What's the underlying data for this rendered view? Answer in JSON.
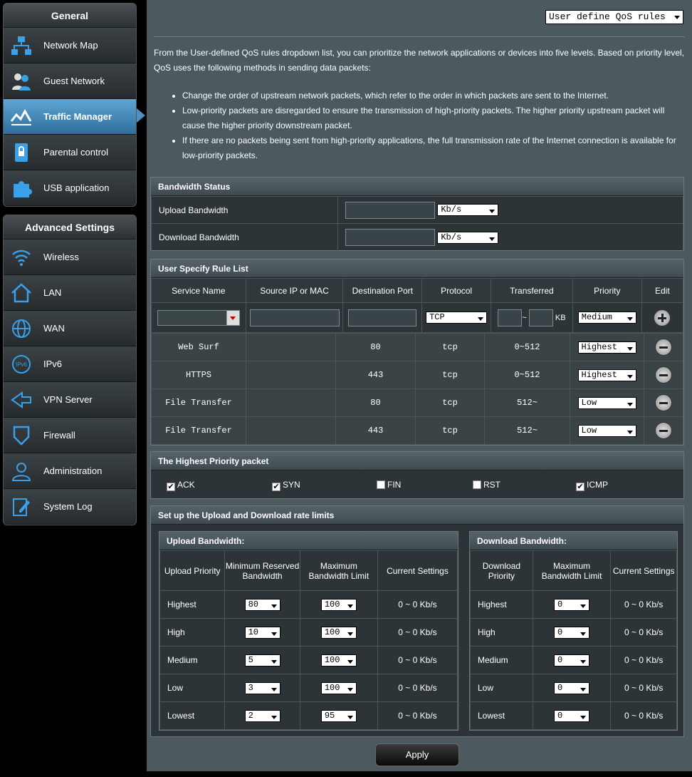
{
  "sidebar": {
    "general_title": "General",
    "general_items": [
      {
        "label": "Network Map",
        "icon": "network-map-icon"
      },
      {
        "label": "Guest Network",
        "icon": "guest-network-icon"
      },
      {
        "label": "Traffic Manager",
        "icon": "traffic-manager-icon",
        "active": true
      },
      {
        "label": "Parental control",
        "icon": "parental-control-icon"
      },
      {
        "label": "USB application",
        "icon": "usb-application-icon"
      }
    ],
    "advanced_title": "Advanced Settings",
    "advanced_items": [
      {
        "label": "Wireless",
        "icon": "wireless-icon"
      },
      {
        "label": "LAN",
        "icon": "lan-icon"
      },
      {
        "label": "WAN",
        "icon": "wan-icon"
      },
      {
        "label": "IPv6",
        "icon": "ipv6-icon"
      },
      {
        "label": "VPN Server",
        "icon": "vpn-server-icon"
      },
      {
        "label": "Firewall",
        "icon": "firewall-icon"
      },
      {
        "label": "Administration",
        "icon": "administration-icon"
      },
      {
        "label": "System Log",
        "icon": "system-log-icon"
      }
    ]
  },
  "qos_mode": "User define QoS rules",
  "description": {
    "intro": "From the User-defined QoS rules dropdown list, you can prioritize the network applications or devices into five levels. Based on priority level, QoS uses the following methods in sending data packets:",
    "bullets": [
      "Change the order of upstream network packets, which refer to the order in which packets are sent to the Internet.",
      "Low-priority packets are disregarded to ensure the transmission of high-priority packets. The higher priority upstream packet will cause the higher priority downstream packet.",
      "If there are no packets being sent from high-priority applications, the full transmission rate of the Internet connection is available for low-priority packets."
    ]
  },
  "bandwidth_status": {
    "title": "Bandwidth Status",
    "upload_label": "Upload Bandwidth",
    "download_label": "Download Bandwidth",
    "unit": "Kb/s"
  },
  "rules": {
    "title": "User Specify Rule List",
    "headers": [
      "Service Name",
      "Source IP or MAC",
      "Destination Port",
      "Protocol",
      "Transferred",
      "Priority",
      "Edit"
    ],
    "new_protocol": "TCP",
    "new_unit": "KB",
    "new_tilde": "~",
    "new_priority": "Medium",
    "rows": [
      {
        "service": "Web Surf",
        "source": "",
        "port": "80",
        "protocol": "tcp",
        "transferred": "0~512",
        "priority": "Highest"
      },
      {
        "service": "HTTPS",
        "source": "",
        "port": "443",
        "protocol": "tcp",
        "transferred": "0~512",
        "priority": "Highest"
      },
      {
        "service": "File Transfer",
        "source": "",
        "port": "80",
        "protocol": "tcp",
        "transferred": "512~",
        "priority": "Low"
      },
      {
        "service": "File Transfer",
        "source": "",
        "port": "443",
        "protocol": "tcp",
        "transferred": "512~",
        "priority": "Low"
      }
    ]
  },
  "highest_priority": {
    "title": "The Highest Priority packet",
    "items": [
      {
        "label": "ACK",
        "checked": true
      },
      {
        "label": "SYN",
        "checked": true
      },
      {
        "label": "FIN",
        "checked": false
      },
      {
        "label": "RST",
        "checked": false
      },
      {
        "label": "ICMP",
        "checked": true
      }
    ]
  },
  "rate_limits": {
    "title": "Set up the Upload and Download rate limits",
    "upload_title": "Upload Bandwidth:",
    "upload_headers": [
      "Upload Priority",
      "Minimum Reserved Bandwidth",
      "Maximum Bandwidth Limit",
      "Current Settings"
    ],
    "upload_rows": [
      {
        "priority": "Highest",
        "min": "80",
        "max": "100",
        "current": "0 ~ 0 Kb/s"
      },
      {
        "priority": "High",
        "min": "10",
        "max": "100",
        "current": "0 ~ 0 Kb/s"
      },
      {
        "priority": "Medium",
        "min": "5",
        "max": "100",
        "current": "0 ~ 0 Kb/s"
      },
      {
        "priority": "Low",
        "min": "3",
        "max": "100",
        "current": "0 ~ 0 Kb/s"
      },
      {
        "priority": "Lowest",
        "min": "2",
        "max": "95",
        "current": "0 ~ 0 Kb/s"
      }
    ],
    "download_title": "Download Bandwidth:",
    "download_headers": [
      "Download Priority",
      "Maximum Bandwidth Limit",
      "Current Settings"
    ],
    "download_rows": [
      {
        "priority": "Highest",
        "max": "0",
        "current": "0 ~ 0 Kb/s"
      },
      {
        "priority": "High",
        "max": "0",
        "current": "0 ~ 0 Kb/s"
      },
      {
        "priority": "Medium",
        "max": "0",
        "current": "0 ~ 0 Kb/s"
      },
      {
        "priority": "Low",
        "max": "0",
        "current": "0 ~ 0 Kb/s"
      },
      {
        "priority": "Lowest",
        "max": "0",
        "current": "0 ~ 0 Kb/s"
      }
    ]
  },
  "apply_label": "Apply"
}
